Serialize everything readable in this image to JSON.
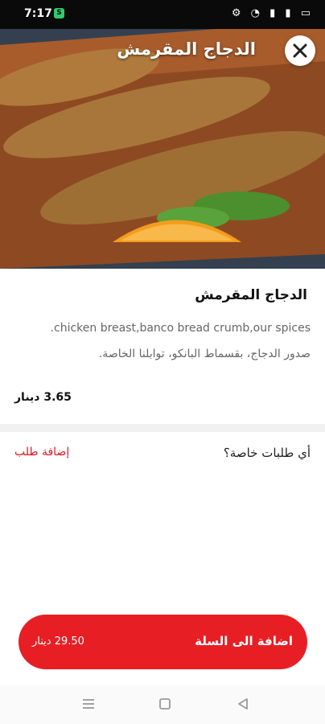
{
  "status_bar": {
    "time": "7:17",
    "app_icon": "S",
    "right_icons": "⚙ ◔ ▮ ▮ ▭"
  },
  "hero": {
    "title": "الدجاج المقرمش",
    "close_icon": "close-icon"
  },
  "product": {
    "name": "الدجاج المقرمش",
    "description_en": ".chicken breast,banco bread crumb,our spices",
    "description_ar": "صدور الدجاج، بقسماط البانكو، توابلنا الخاصة.",
    "price": "3.65 دينار"
  },
  "special_requests": {
    "label": "أي طلبات خاصة؟",
    "add_note": "إضافة طلب"
  },
  "cart": {
    "label": "اضافة الى السلة",
    "price": "29.50 دينار"
  },
  "colors": {
    "accent": "#e81e25",
    "accent_text": "#e3141f"
  },
  "nav_icons": [
    "menu-icon",
    "home-icon",
    "back-icon"
  ]
}
